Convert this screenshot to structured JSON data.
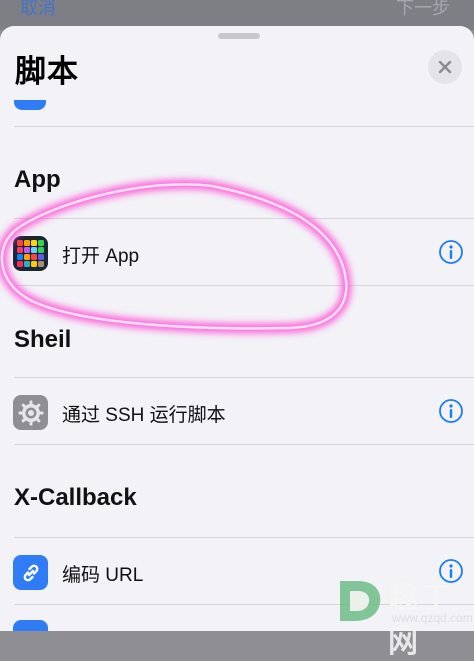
{
  "background_sheet": {
    "left_label": "取消",
    "right_label": "下一步"
  },
  "sheet": {
    "title": "脚本"
  },
  "sections": [
    {
      "title": "App",
      "items": [
        {
          "label": "打开 App",
          "icon": "app-grid-icon"
        }
      ]
    },
    {
      "title": "Sheil",
      "items": [
        {
          "label": "通过 SSH 运行脚本",
          "icon": "gear-icon"
        }
      ]
    },
    {
      "title": "X-Callback",
      "items": [
        {
          "label": "编码 URL",
          "icon": "link-icon"
        }
      ]
    }
  ],
  "colors": {
    "accent": "#1a7cf2",
    "sheet_bg": "#f2f2f7",
    "annotation": "#ff4fd6",
    "link_icon_bg": "#2f7cf6",
    "gear_icon_bg": "#8e8e93"
  },
  "watermark": {
    "brand": "趣丁网",
    "url": "www.qzqd.com"
  }
}
